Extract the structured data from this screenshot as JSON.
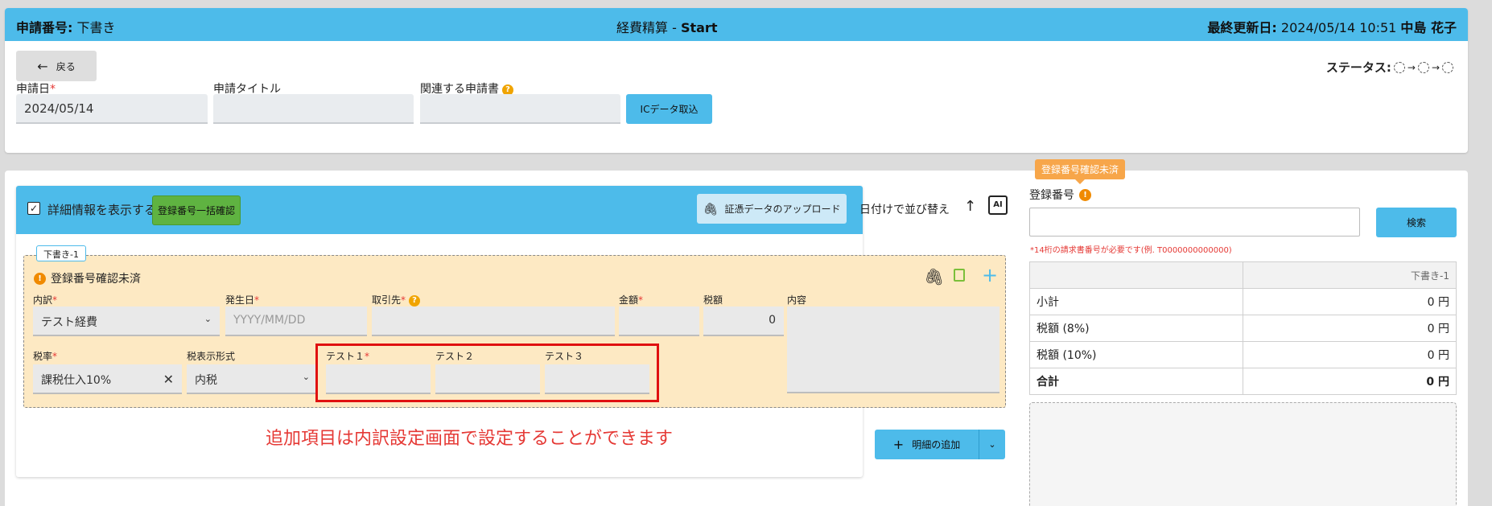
{
  "header": {
    "application_label": "申請番号",
    "application_value": "下書き",
    "title_main": "経費精算 - ",
    "title_bold": "Start",
    "updated_label": "最終更新日",
    "updated_value": "2024/05/14 10:51",
    "updated_user": "中島 花子"
  },
  "toolbar": {
    "back_label": "戻る",
    "status_label": "ステータス:"
  },
  "form": {
    "date_label": "申請日",
    "date_value": "2024/05/14",
    "title_label": "申請タイトル",
    "title_value": "",
    "related_label": "関連する申請書",
    "ic_button": "ICデータ取込"
  },
  "detail": {
    "show_detail_label": "詳細情報を表示する",
    "bulk_check_button": "登録番号一括確認",
    "upload_button": "証憑データのアップロード",
    "sort_label": "日付けで並び替え",
    "ai_label": "AI",
    "draft_tag": "下書き-1",
    "warning_text": "登録番号確認未済",
    "fields": {
      "category_label": "内訳",
      "category_value": "テスト経費",
      "date_label": "発生日",
      "date_placeholder": "YYYY/MM/DD",
      "vendor_label": "取引先",
      "amount_label": "金額",
      "tax_label": "税額",
      "tax_value": "0",
      "content_label": "内容",
      "tax_rate_label": "税率",
      "tax_rate_value": "課税仕入10%",
      "tax_display_label": "税表示形式",
      "tax_display_value": "内税",
      "test1_label": "テスト１",
      "test2_label": "テスト２",
      "test3_label": "テスト３"
    },
    "note": "追加項目は内訳設定画面で設定することができます",
    "add_button": "明細の追加"
  },
  "registration": {
    "tooltip": "登録番号確認未済",
    "label": "登録番号",
    "input_value": "",
    "search_button": "検索",
    "hint": "*14桁の請求書番号が必要です(例. T0000000000000)"
  },
  "summary": {
    "column_header": "下書き-1",
    "rows": [
      {
        "label": "小計",
        "value": "0 円"
      },
      {
        "label": "税額 (8%)",
        "value": "0 円"
      },
      {
        "label": "税額 (10%)",
        "value": "0 円"
      },
      {
        "label": "合計",
        "value": "0 円"
      }
    ]
  },
  "colors": {
    "accent": "#4dbbea",
    "bulk_button": "#5fb341",
    "warning": "#f08a00",
    "draft_bg": "#fde9c3",
    "highlight_box": "#e01010"
  }
}
